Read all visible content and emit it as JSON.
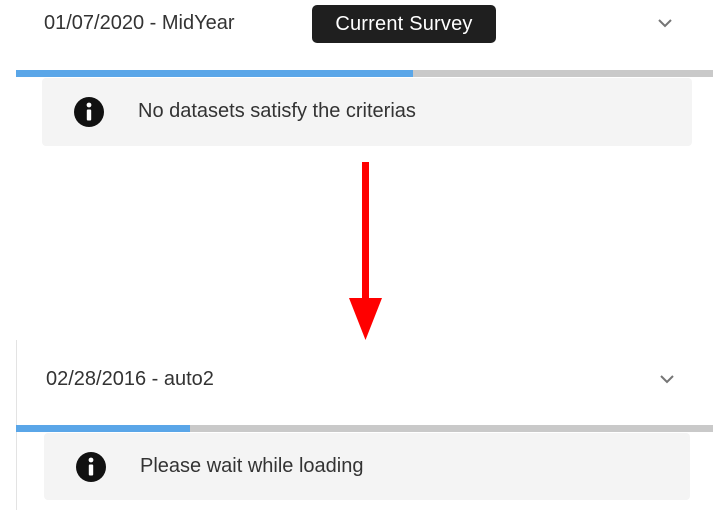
{
  "colors": {
    "progress_fill": "#5aa6e8",
    "progress_track": "#c9c9c9",
    "badge_bg": "#1f1f1f",
    "alert_bg": "#f4f4f4",
    "arrow": "#ff0000"
  },
  "before": {
    "header": {
      "title": "01/07/2020 - MidYear",
      "badge": "Current Survey",
      "toggle_icon": "chevron-down-icon"
    },
    "progress_fraction": 0.57,
    "alert": {
      "icon": "info-icon",
      "message": "No datasets satisfy the criterias"
    }
  },
  "transition_icon": "arrow-down-icon",
  "after": {
    "header": {
      "title": "02/28/2016 - auto2",
      "toggle_icon": "chevron-down-icon"
    },
    "progress_fraction": 0.25,
    "alert": {
      "icon": "info-icon",
      "message": "Please wait while loading"
    }
  }
}
